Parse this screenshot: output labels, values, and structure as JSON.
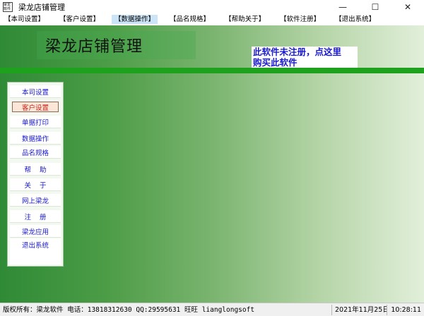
{
  "window": {
    "icon_text": "梁龙软件",
    "title": "梁龙店铺管理",
    "controls": {
      "minimize": "—",
      "maximize": "☐",
      "close": "✕"
    }
  },
  "menubar": {
    "items": [
      {
        "label": "【本司设置】"
      },
      {
        "label": "【客户设置】"
      },
      {
        "label": "【数据操作】"
      },
      {
        "label": "【品名规格】"
      },
      {
        "label": "【帮助关于】"
      },
      {
        "label": "【软件注册】"
      },
      {
        "label": "【退出系统】"
      }
    ],
    "active_index": 2
  },
  "banner": {
    "title": "梁龙店铺管理",
    "registration_notice": "此软件未注册，点这里\n购买此软件"
  },
  "sidebar": {
    "items": [
      {
        "label": "本司设置"
      },
      {
        "label": "客户设置"
      },
      {
        "label": "单据打印"
      },
      {
        "label": "数据操作"
      },
      {
        "label": "品名规格"
      },
      {
        "label": "帮    助"
      },
      {
        "label": "关    于"
      },
      {
        "label": "网上梁龙"
      },
      {
        "label": "注    册"
      },
      {
        "label": "梁龙应用"
      },
      {
        "label": "退出系统"
      }
    ],
    "selected_index": 1
  },
  "statusbar": {
    "copyright": "版权所有：梁龙软件 电话：13818312630 QQ:29595631 旺旺 lianglongsoft",
    "date": "2021年11月25日",
    "time": "10:28:11"
  },
  "colors": {
    "accent_stripe": "#1ea21e",
    "link_blue": "#1a1ad0",
    "selected_red": "#c8271b",
    "active_menu": "#cce4f7"
  }
}
